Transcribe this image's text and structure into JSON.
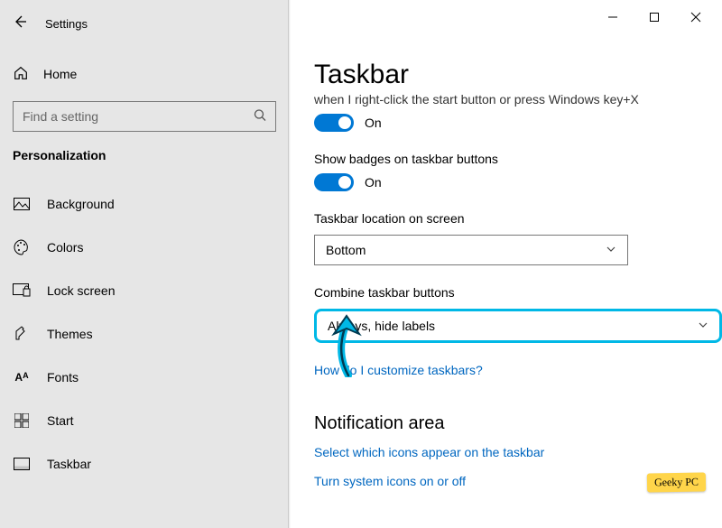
{
  "header": {
    "app_title": "Settings"
  },
  "sidebar": {
    "home_label": "Home",
    "search_placeholder": "Find a setting",
    "section_label": "Personalization",
    "items": [
      {
        "label": "Background"
      },
      {
        "label": "Colors"
      },
      {
        "label": "Lock screen"
      },
      {
        "label": "Themes"
      },
      {
        "label": "Fonts"
      },
      {
        "label": "Start"
      },
      {
        "label": "Taskbar"
      }
    ]
  },
  "main": {
    "page_title": "Taskbar",
    "cut_text": "when I right-click the start button or press Windows key+X",
    "toggle1_state": "On",
    "badges_label": "Show badges on taskbar buttons",
    "toggle2_state": "On",
    "location_label": "Taskbar location on screen",
    "location_value": "Bottom",
    "combine_label": "Combine taskbar buttons",
    "combine_value": "Always, hide labels",
    "help_link": "How do I customize taskbars?",
    "notif_heading": "Notification area",
    "notif_link1": "Select which icons appear on the taskbar",
    "notif_link2": "Turn system icons on or off"
  },
  "watermark": "Geeky PC"
}
